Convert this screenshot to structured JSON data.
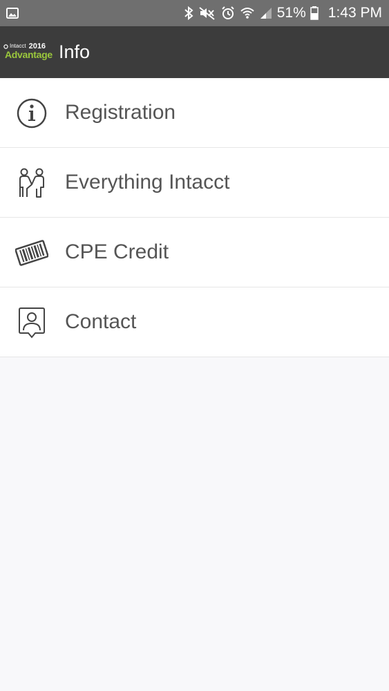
{
  "status_bar": {
    "left_icon": "image-notification-icon",
    "icons": [
      "bluetooth-icon",
      "mute-icon",
      "alarm-icon",
      "wifi-icon",
      "signal-icon",
      "battery-icon"
    ],
    "battery": "51%",
    "time": "1:43 PM"
  },
  "app_bar": {
    "logo": {
      "brand": "Intacct",
      "year": "2016",
      "product": "Advantage"
    },
    "title": "Info"
  },
  "menu": {
    "items": [
      {
        "label": "Registration",
        "icon": "info-icon"
      },
      {
        "label": "Everything Intacct",
        "icon": "people-handshake-icon"
      },
      {
        "label": "CPE Credit",
        "icon": "barcode-icon"
      },
      {
        "label": "Contact",
        "icon": "contact-card-icon"
      }
    ]
  },
  "colors": {
    "status_bar_bg": "#6f6f6f",
    "app_bar_bg": "#3c3c3c",
    "logo_accent": "#9bc83c",
    "list_bg": "#ffffff",
    "page_bg": "#f8f8fa",
    "label_text": "#555555"
  }
}
